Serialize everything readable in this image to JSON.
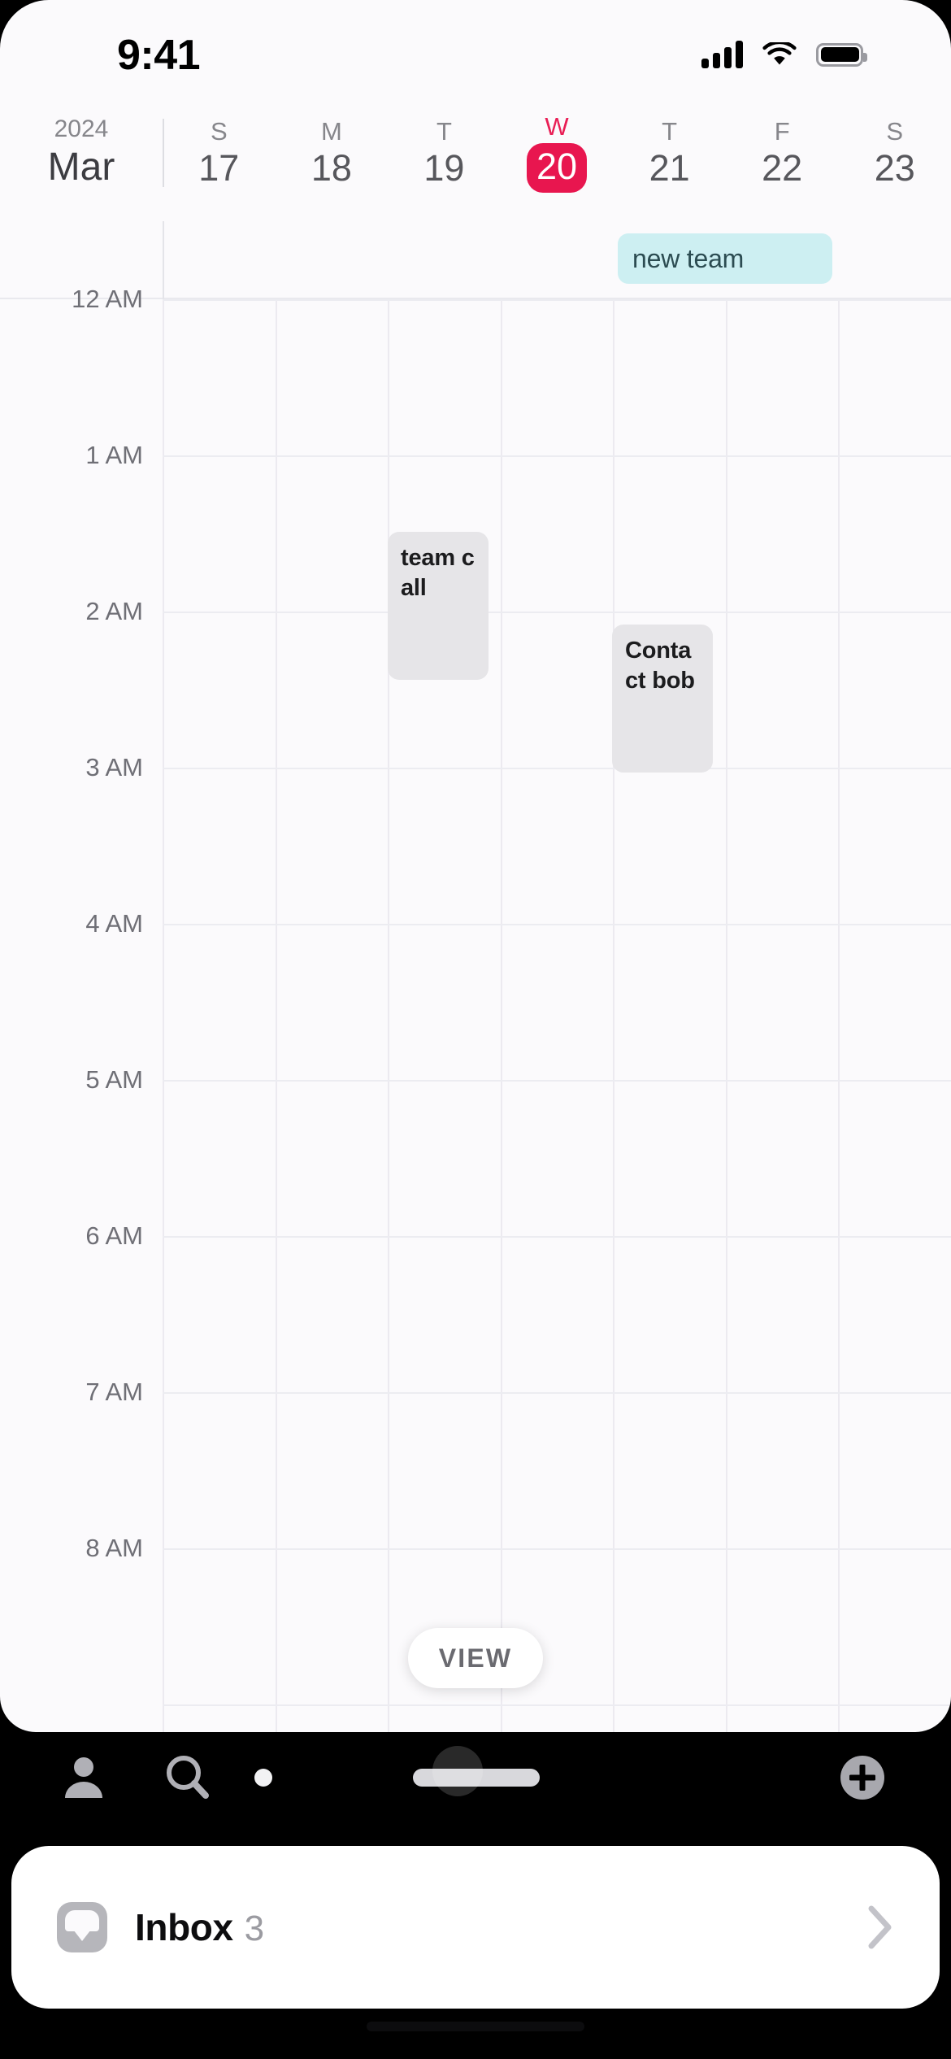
{
  "status_bar": {
    "time": "9:41",
    "cellular_icon": "signal-bars-icon",
    "wifi_icon": "wifi-icon",
    "battery_icon": "battery-icon"
  },
  "header": {
    "year": "2024",
    "month": "Mar",
    "days": [
      {
        "dow": "S",
        "num": "17",
        "today": false
      },
      {
        "dow": "M",
        "num": "18",
        "today": false
      },
      {
        "dow": "T",
        "num": "19",
        "today": false
      },
      {
        "dow": "W",
        "num": "20",
        "today": true
      },
      {
        "dow": "T",
        "num": "21",
        "today": false
      },
      {
        "dow": "F",
        "num": "22",
        "today": false
      },
      {
        "dow": "S",
        "num": "23",
        "today": false
      }
    ],
    "today_accent_color": "#e8164f"
  },
  "all_day": {
    "events": [
      {
        "title": "new team",
        "bg_color": "#cdeff2",
        "text_color": "#2c4c52"
      }
    ]
  },
  "time_grid": {
    "hours": [
      "12 AM",
      "1 AM",
      "2 AM",
      "3 AM",
      "4 AM",
      "5 AM",
      "6 AM",
      "7 AM",
      "8 AM"
    ],
    "events": [
      {
        "title": "team call",
        "day": "19",
        "bg_color": "#e6e5e8",
        "text_color": "#1c1c1e"
      },
      {
        "title": "Contact bob",
        "day": "21",
        "bg_color": "#e6e5e8",
        "text_color": "#1c1c1e"
      }
    ]
  },
  "view_button": {
    "label": "VIEW"
  },
  "toolbar": {
    "person_icon": "person-icon",
    "search_icon": "search-icon",
    "dot_icon": "dot-icon",
    "drag_handle_icon": "drag-handle-icon",
    "add_icon": "plus-circle-icon"
  },
  "inbox": {
    "icon": "inbox-tray-icon",
    "label": "Inbox",
    "count": "3",
    "chevron_icon": "chevron-right-icon"
  }
}
